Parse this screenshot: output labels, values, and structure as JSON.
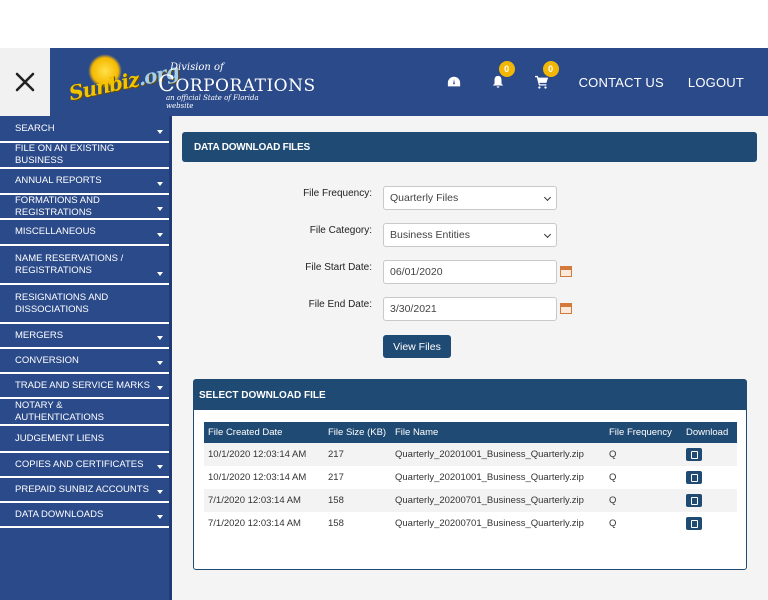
{
  "header": {
    "logo": {
      "sunbiz": "Sunbiz",
      "org": ".org",
      "division_of": "Division of",
      "corporations_c": "C",
      "corporations_rest": "ORPORATIONS",
      "tagline": "an official State of Florida website"
    },
    "icons": {
      "dashboard": "dashboard-icon",
      "notifications": "bell-icon",
      "cart": "cart-icon"
    },
    "notification_count": "0",
    "cart_count": "0",
    "contact_label": "CONTACT US",
    "logout_label": "LOGOUT"
  },
  "sidebar": {
    "items": [
      {
        "label": "SEARCH"
      },
      {
        "label": "FILE ON AN EXISTING BUSINESS"
      },
      {
        "label": "ANNUAL REPORTS"
      },
      {
        "label": "FORMATIONS AND REGISTRATIONS"
      },
      {
        "label": "MISCELLANEOUS"
      },
      {
        "label": "NAME RESERVATIONS / REGISTRATIONS"
      },
      {
        "label": "RESIGNATIONS AND DISSOCIATIONS"
      },
      {
        "label": "MERGERS"
      },
      {
        "label": "CONVERSION"
      },
      {
        "label": "TRADE AND SERVICE MARKS"
      },
      {
        "label": "NOTARY & AUTHENTICATIONS"
      },
      {
        "label": "JUDGEMENT LIENS"
      },
      {
        "label": "COPIES AND CERTIFICATES"
      },
      {
        "label": "PREPAID SUNBIZ ACCOUNTS"
      },
      {
        "label": "DATA DOWNLOADS"
      }
    ]
  },
  "main": {
    "panel_title": "DATA DOWNLOAD FILES",
    "form": {
      "frequency_label": "File Frequency:",
      "frequency_value": "Quarterly Files",
      "category_label": "File Category:",
      "category_value": "Business Entities",
      "start_label": "File Start Date:",
      "start_value": "06/01/2020",
      "end_label": "File End Date:",
      "end_value": "3/30/2021",
      "view_button": "View Files"
    },
    "downloads": {
      "title": "SELECT DOWNLOAD FILE",
      "columns": [
        "File Created Date",
        "File Size (KB)",
        "File Name",
        "File Frequency",
        "Download"
      ],
      "rows": [
        {
          "created": "10/1/2020 12:03:14 AM",
          "size": "217",
          "name": "Quarterly_20201001_Business_Quarterly.zip",
          "frequency": "Q"
        },
        {
          "created": "10/1/2020 12:03:14 AM",
          "size": "217",
          "name": "Quarterly_20201001_Business_Quarterly.zip",
          "frequency": "Q"
        },
        {
          "created": "7/1/2020 12:03:14 AM",
          "size": "158",
          "name": "Quarterly_20200701_Business_Quarterly.zip",
          "frequency": "Q"
        },
        {
          "created": "7/1/2020 12:03:14 AM",
          "size": "158",
          "name": "Quarterly_20200701_Business_Quarterly.zip",
          "frequency": "Q"
        }
      ]
    }
  },
  "colors": {
    "header_bg": "#2b4a8a",
    "panel_bg": "#1f4a73",
    "badge": "#f2b705",
    "main_bg": "#f4f4f4"
  }
}
